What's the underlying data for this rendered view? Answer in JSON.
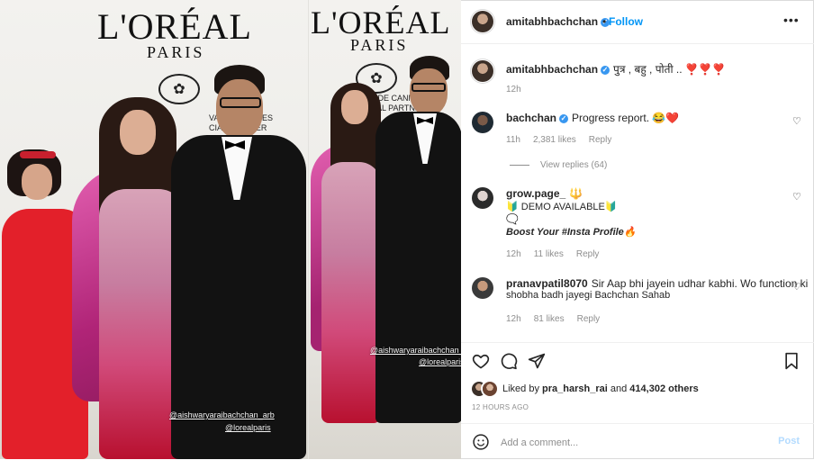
{
  "post": {
    "author": "amitabhbachchan",
    "follow_label": "Follow",
    "dot": "•",
    "more_icon": "more-icon",
    "caption_user": "amitabhbachchan",
    "caption_text": "पुत्र , बहु , पोती .. ❣️❣️❣️",
    "caption_time": "12h"
  },
  "media": {
    "brand_big_1": "L'ORÉAL",
    "brand_small_1": "PARIS",
    "brand_big_2": "L'ORÉAL",
    "brand_small_2": "PARIS",
    "cannes_text": "VAL DE CANNES\nCIAL PARTNER",
    "cannes_text_2": "VAL DE CANNES\nFICIAL PARTNER",
    "tag1_a": "@aishwaryaraibachchan_arb",
    "tag1_b": "@lorealparis",
    "tag2_a": "@aishwaryaraibachchan_arb",
    "tag2_b": "@lorealparis"
  },
  "comments": [
    {
      "user": "bachchan",
      "verified": true,
      "text": "Progress report. 😂❤️",
      "time": "11h",
      "likes": "2,381 likes",
      "reply": "Reply",
      "view_replies": "View replies (64)"
    },
    {
      "user": "grow.page_",
      "tail": "🔱",
      "line1": "🔰 DEMO AVAILABLE🔰",
      "line2": "🗨️",
      "line3": "Boost Your #Insta Profile🔥",
      "time": "12h",
      "likes": "11 likes",
      "reply": "Reply"
    },
    {
      "user": "pranavpatil8070",
      "text": "Sir Aap bhi jayein udhar kabhi. Wo function ki",
      "text2": "shobha badh jayegi Bachchan Sahab",
      "time": "12h",
      "likes": "81 likes",
      "reply": "Reply"
    }
  ],
  "likes_bar": {
    "prefix": "Liked by",
    "user": "pra_harsh_rai",
    "and": "and",
    "count": "414,302 others",
    "ago": "12 HOURS AGO"
  },
  "composer": {
    "placeholder": "Add a comment...",
    "post_label": "Post"
  },
  "icons": [
    "heart-icon",
    "comment-icon",
    "share-icon",
    "bookmark-icon",
    "emoji-icon"
  ],
  "colors": {
    "accent": "#0095f6",
    "muted": "#8e8e8e",
    "text": "#262626",
    "border": "#dbdbdb"
  }
}
